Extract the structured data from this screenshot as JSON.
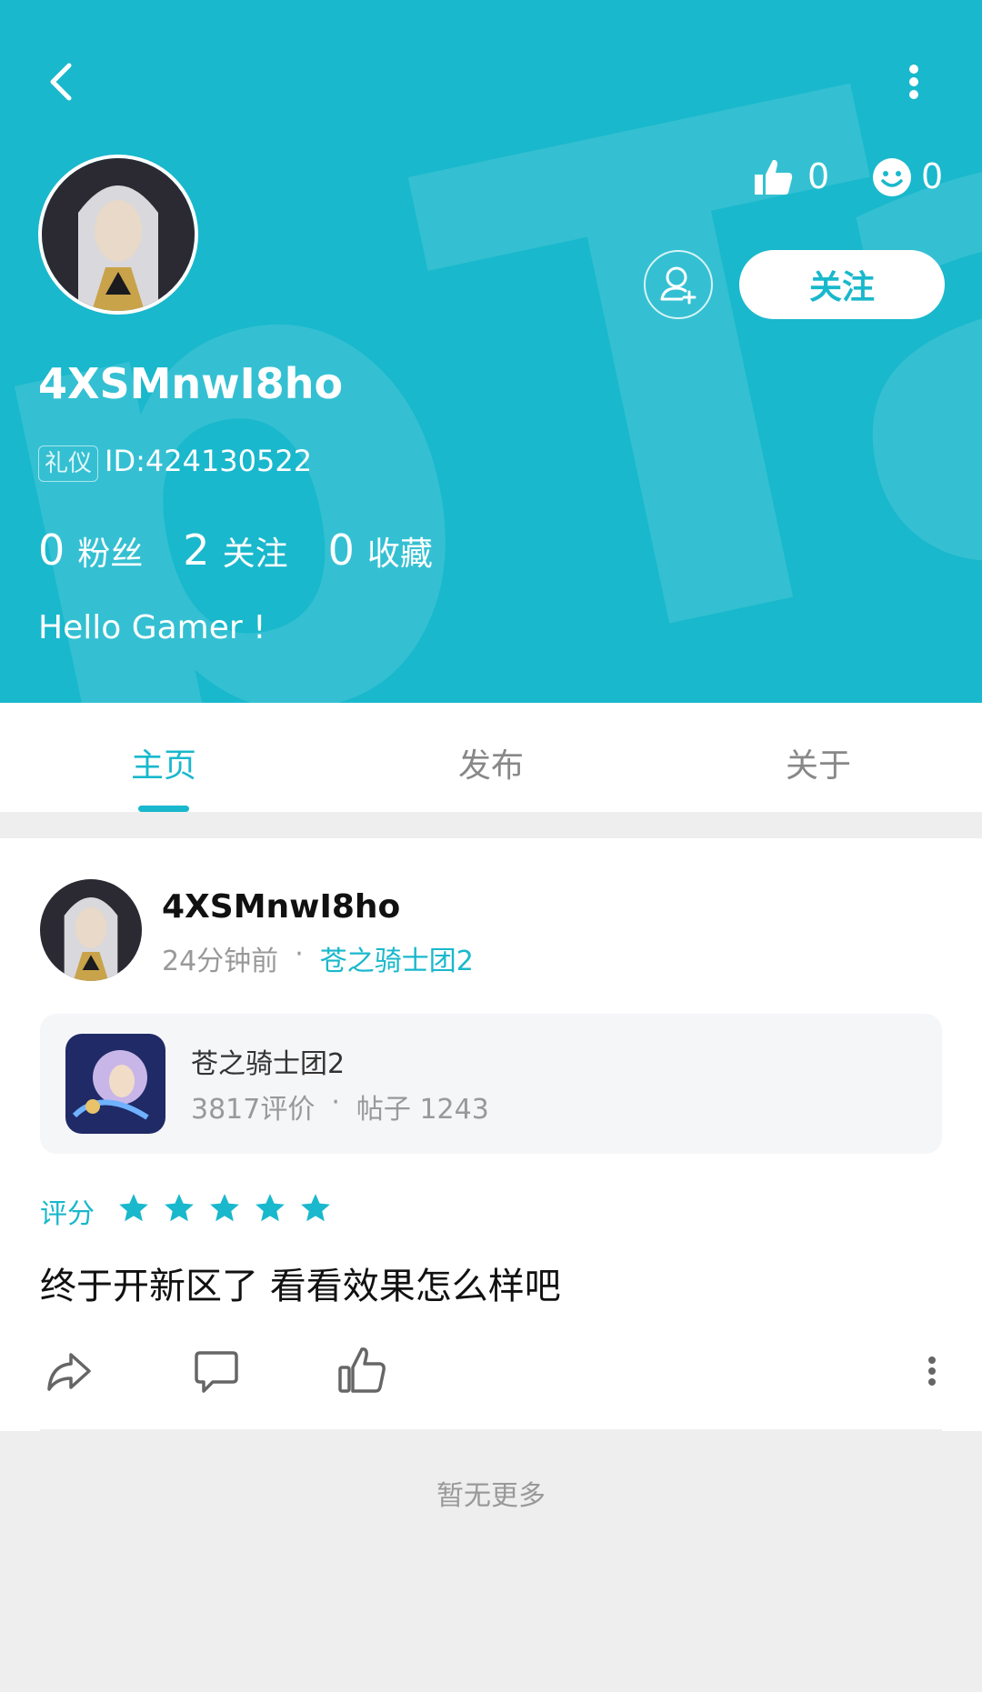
{
  "header": {
    "watermark": "pTap",
    "likes_count": "0",
    "smiles_count": "0",
    "follow_label": "关注",
    "username": "4XSMnwI8ho",
    "badge": "礼仪",
    "user_id": "ID:424130522",
    "stats": [
      {
        "num": "0",
        "label": "粉丝"
      },
      {
        "num": "2",
        "label": "关注"
      },
      {
        "num": "0",
        "label": "收藏"
      }
    ],
    "bio": "Hello Gamer !"
  },
  "tabs": [
    "主页",
    "发布",
    "关于"
  ],
  "active_tab": "主页",
  "post": {
    "author": "4XSMnwI8ho",
    "time": "24分钟前",
    "dot": "·",
    "game_link": "苍之骑士团2",
    "game": {
      "name": "苍之骑士团2",
      "reviews": "3817评价",
      "posts": "帖子 1243"
    },
    "rating_label": "评分",
    "rating": 5,
    "content": "终于开新区了 看看效果怎么样吧"
  },
  "footer": {
    "no_more": "暂无更多"
  },
  "colors": {
    "accent": "#19b8cc",
    "background": "#eeeeee"
  }
}
